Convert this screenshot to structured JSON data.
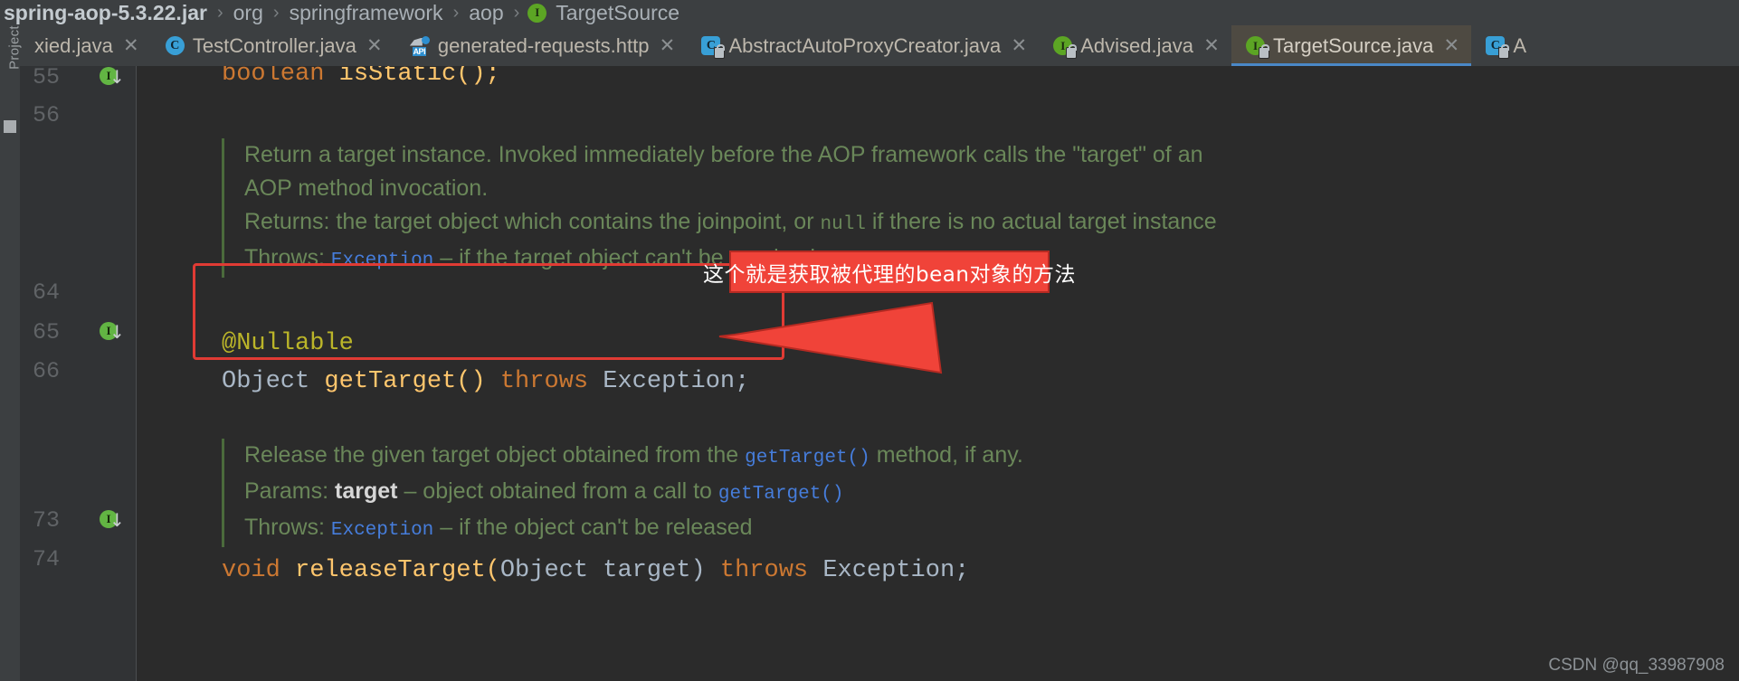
{
  "breadcrumb": {
    "separator": "›",
    "items": [
      {
        "label": "spring-aop-5.3.22.jar",
        "icon": "",
        "bold": true
      },
      {
        "label": "org",
        "icon": "",
        "bold": false
      },
      {
        "label": "springframework",
        "icon": "",
        "bold": false
      },
      {
        "label": "aop",
        "icon": "",
        "bold": false
      },
      {
        "label": "TargetSource",
        "icon": "interface-icon",
        "bold": false
      }
    ]
  },
  "tabs": [
    {
      "label": "xied.java",
      "icon": "none",
      "close": "✕",
      "active": false
    },
    {
      "label": "TestController.java",
      "icon": "class-icon",
      "close": "✕",
      "active": false
    },
    {
      "label": "generated-requests.http",
      "icon": "http-request-icon",
      "close": "✕",
      "active": false
    },
    {
      "label": "AbstractAutoProxyCreator.java",
      "icon": "class-locked-icon",
      "close": "✕",
      "active": false
    },
    {
      "label": "Advised.java",
      "icon": "interface-locked-icon",
      "close": "✕",
      "active": false
    },
    {
      "label": "TargetSource.java",
      "icon": "interface-locked-icon",
      "close": "✕",
      "active": true
    },
    {
      "label": "A",
      "icon": "class-locked-icon",
      "close": "",
      "active": false
    }
  ],
  "toolwindow": {
    "label": "Project"
  },
  "gutter": {
    "lines": [
      {
        "num": "55",
        "marker": "implemented-method-marker"
      },
      {
        "num": "56",
        "marker": ""
      },
      {
        "num": "64",
        "marker": ""
      },
      {
        "num": "65",
        "marker": "implemented-method-marker"
      },
      {
        "num": "66",
        "marker": ""
      },
      {
        "num": "73",
        "marker": "implemented-method-marker"
      },
      {
        "num": "74",
        "marker": ""
      }
    ],
    "marker_glyph": "I",
    "marker_arrow": "↓"
  },
  "code": {
    "line_55": {
      "ret": "boolean",
      "name": " isStatic();"
    },
    "nullable_annotation": "@Nullable",
    "get_target": {
      "type": "Object",
      "name": " getTarget()",
      "kw": " throws",
      "tail": " Exception;"
    },
    "release_target": {
      "kw": "void",
      "name": " releaseTarget(",
      "param_type": "Object",
      "param_name": " target)",
      "kw2": " throws",
      "tail": " Exception;"
    }
  },
  "javadoc_top": {
    "line1": "Return a target instance. Invoked immediately before the AOP framework calls the \"target\" of an",
    "line2": "AOP method invocation.",
    "returns_label": "Returns:",
    "returns_text_a": " the target object which contains the joinpoint, or ",
    "returns_code": "null",
    "returns_text_b": " if there is no actual target instance",
    "throws_label": "Throws:",
    "throws_link": "Exception",
    "throws_text": " – if the target object can't be resolved"
  },
  "javadoc_bottom": {
    "line1_a": "Release the given target object obtained from the ",
    "line1_link": "getTarget()",
    "line1_b": " method, if any.",
    "params_label": "Params:",
    "params_name": "target",
    "params_text": " – object obtained from a call to ",
    "params_link": "getTarget()",
    "throws_label": "Throws:",
    "throws_link": "Exception",
    "throws_text": " – if the object can't be released"
  },
  "annotation": {
    "callout_text": "这个就是获取被代理的bean对象的方法",
    "box_color": "#e03b34",
    "callout_bg": "#f04339"
  },
  "watermark": {
    "text": "CSDN @qq_33987908"
  }
}
